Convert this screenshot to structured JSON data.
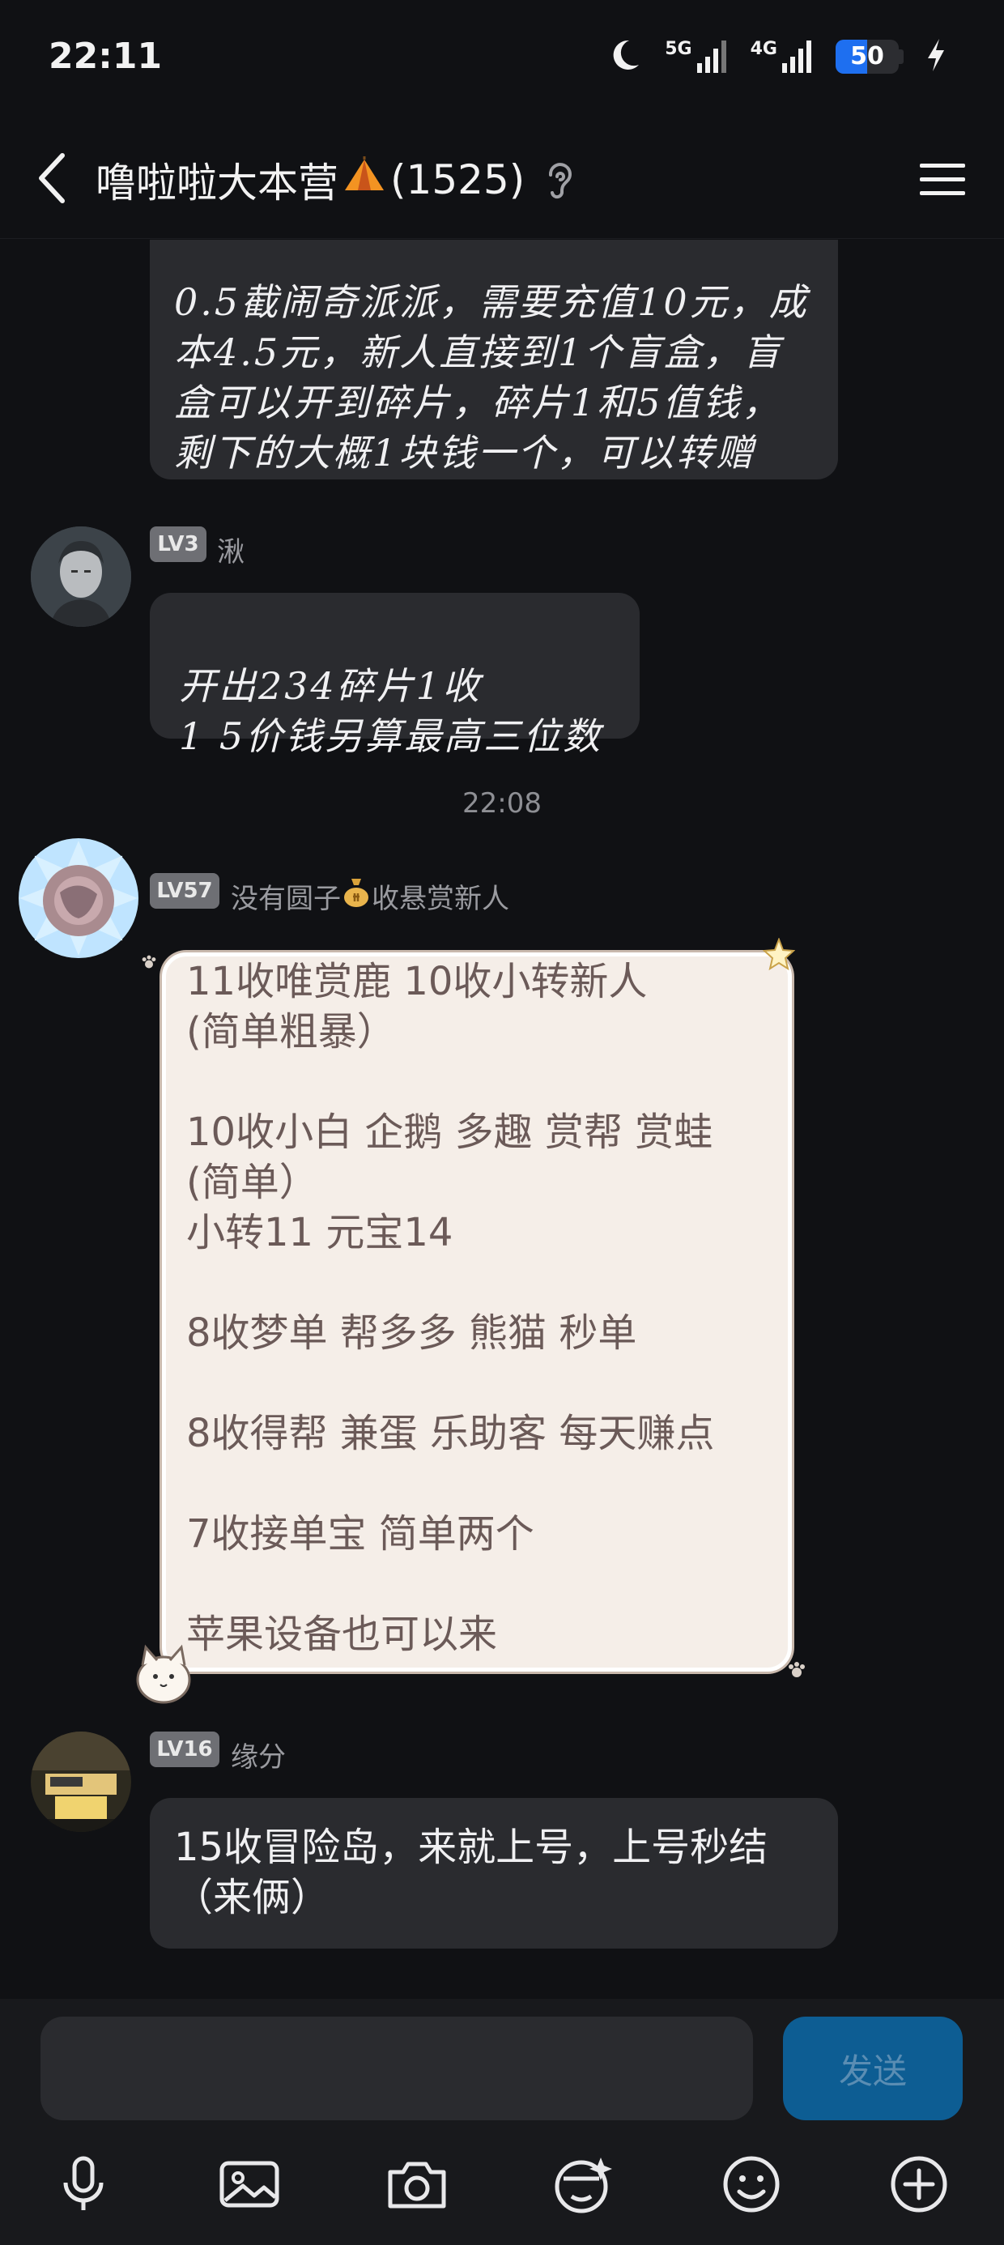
{
  "status_bar": {
    "time": "22:11",
    "network_5g": "5G",
    "network_4g": "4G",
    "battery_level": "50",
    "battery_color": "#1e6ff0"
  },
  "header": {
    "title_main": "噜啦啦大本营",
    "title_count": "(1525)",
    "icons": [
      "back-icon",
      "tent-emoji",
      "ear-icon",
      "menu-icon"
    ]
  },
  "messages": [
    {
      "text": "0.5截闹奇派派，需要充值10元，成本4.5元，新人直接到1个盲盒，盲盒可以开到碎片，碎片1和5值钱，剩下的大概1块钱一个，可以转赠"
    },
    {
      "level": "LV3",
      "name": "湫",
      "text": "开出234碎片1收\n1 5价钱另算最高三位数"
    },
    {
      "level": "LV57",
      "name_prefix": "没有圆子",
      "name_suffix": "收悬赏新人",
      "text": "11收唯赏鹿 10收小转新人\n(简单粗暴）\n\n10收小白 企鹅 多趣 赏帮 赏蛙\n(简单）\n小转11 元宝14\n\n8收梦单 帮多多 熊猫 秒单\n\n8收得帮 兼蛋 乐助客 每天赚点\n\n7收接单宝 简单两个\n\n苹果设备也可以来"
    },
    {
      "level": "LV16",
      "name": "缘分",
      "text": "15收冒险岛，来就上号，上号秒结（来俩）"
    }
  ],
  "timestamp": "22:08",
  "input": {
    "placeholder": "",
    "send_label": "发送"
  },
  "toolbar": [
    "microphone-icon",
    "image-icon",
    "camera-icon",
    "sticker-icon",
    "emoji-icon",
    "add-icon"
  ]
}
